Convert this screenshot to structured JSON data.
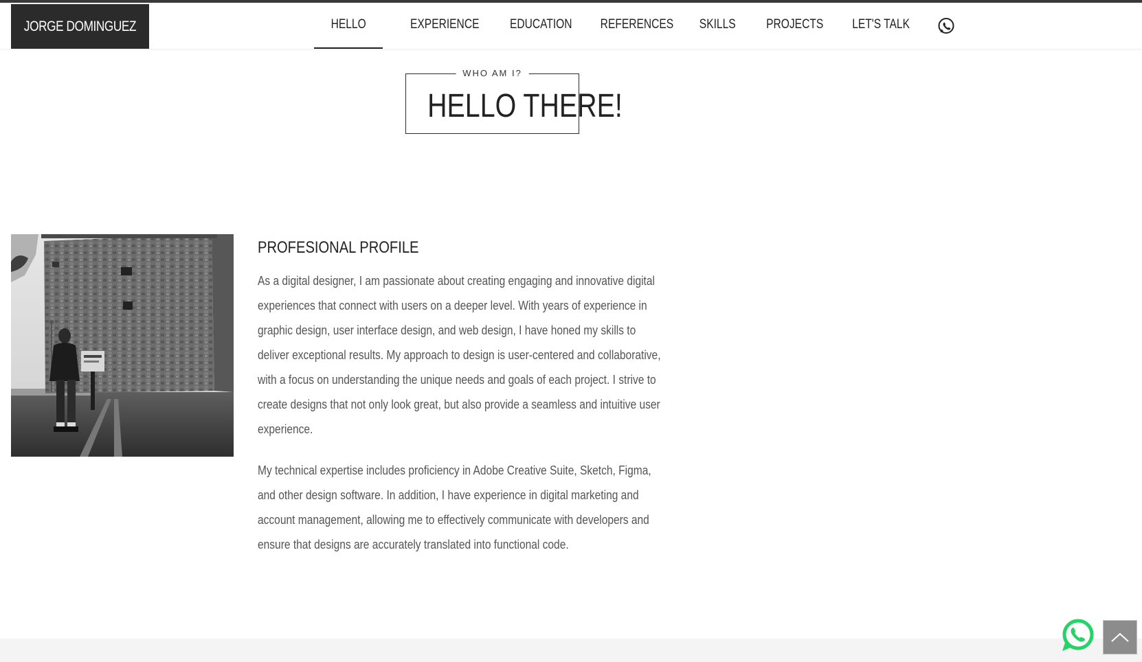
{
  "header": {
    "logo": "JORGE DOMINGUEZ",
    "nav": [
      {
        "label": "HELLO",
        "active": true
      },
      {
        "label": "EXPERIENCE",
        "active": false
      },
      {
        "label": "EDUCATION",
        "active": false
      },
      {
        "label": "REFERENCES",
        "active": false
      },
      {
        "label": "SKILLS",
        "active": false
      },
      {
        "label": "PROJECTS",
        "active": false
      },
      {
        "label": "LET'S TALK",
        "active": false
      }
    ],
    "whatsapp_icon": "whatsapp-icon"
  },
  "intro": {
    "kicker": "WHO AM I?",
    "title": "HELLO THERE!"
  },
  "profile": {
    "photo_icon": "profile-photo",
    "title": "PROFESIONAL PROFILE",
    "paragraph1_lines": [
      "As a digital designer, I am passionate about creating engaging and innovative digital",
      "experiences that connect with users on a deeper level. With years of experience in",
      "graphic design, user interface design, and web design, I have honed my skills to",
      "deliver exceptional results. My approach to design is user-centered and collaborative,",
      "with a focus on understanding the unique needs and goals of each project. I strive to",
      "create designs that not only look great, but also provide a seamless and intuitive user",
      "experience."
    ],
    "paragraph2_lines": [
      "My technical expertise includes proficiency in Adobe Creative Suite, Sketch, Figma,",
      "and other design software. In addition, I have experience in digital marketing and",
      "account management, allowing me to effectively communicate with developers and",
      "ensure that designs are accurately translated into functional code."
    ]
  },
  "floating": {
    "whatsapp_icon": "whatsapp-icon",
    "back_to_top_icon": "chevron-up-icon"
  },
  "colors": {
    "dark": "#2b2b2b",
    "text": "#555555",
    "whatsapp_green": "#25d366",
    "footer_band": "#f4f4f4"
  }
}
